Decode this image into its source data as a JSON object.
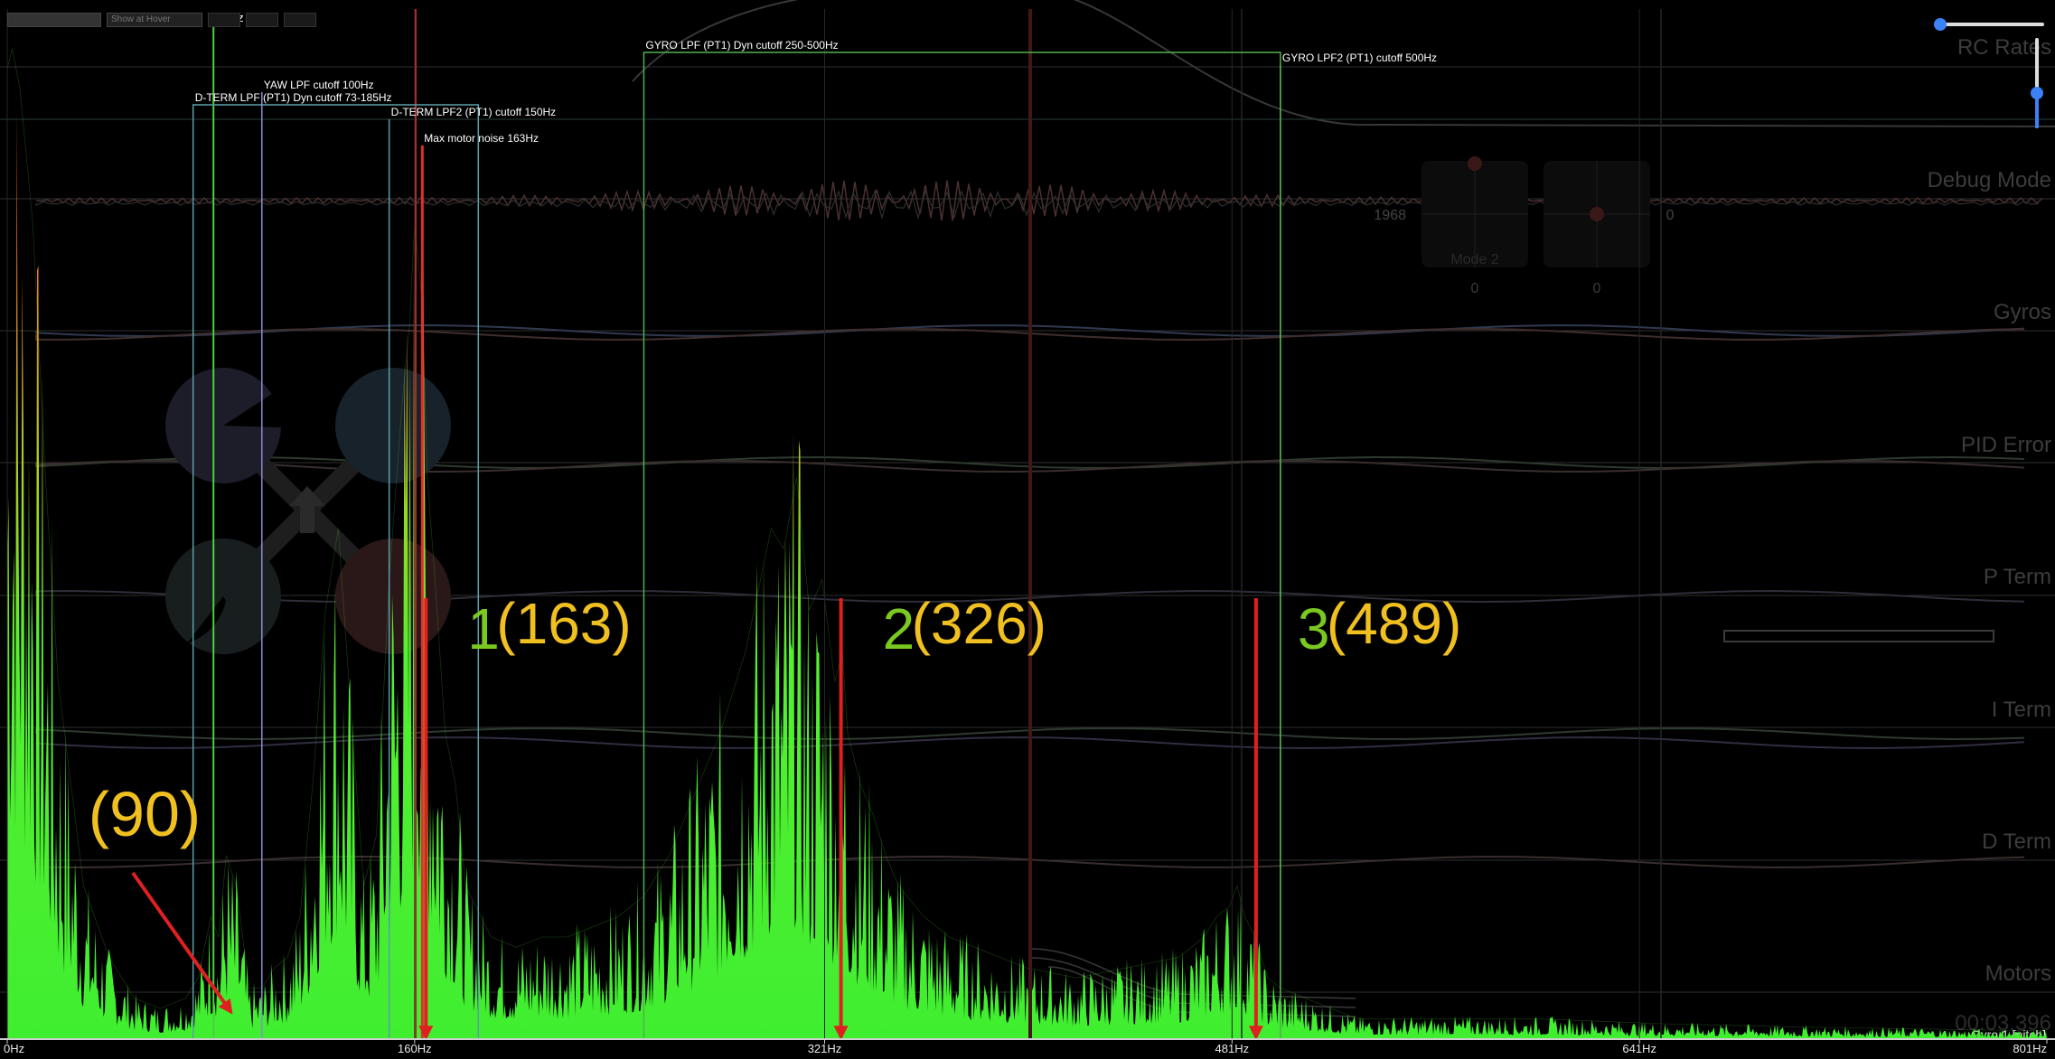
{
  "toolbar": {
    "select_value": "",
    "search_placeholder": "Show at Hover",
    "buttons": [
      "",
      "",
      ""
    ],
    "freq_readout": "81Hz"
  },
  "traces": [
    {
      "label": "RC Rates"
    },
    {
      "label": "Debug Mode"
    },
    {
      "label": "Gyros"
    },
    {
      "label": "PID Error"
    },
    {
      "label": "P Term"
    },
    {
      "label": "I Term"
    },
    {
      "label": "D Term"
    },
    {
      "label": "Motors"
    }
  ],
  "stick_overlay": {
    "mode_label": "Mode 2",
    "left_value": "1968",
    "right_value": "0",
    "bottom_left": "0",
    "bottom_right": "0"
  },
  "timestamp": "00:03.396",
  "spectrum_label": "Gyro 1 [pitch]",
  "chart_data": {
    "type": "area",
    "title": "",
    "xlabel": "",
    "ylabel": "",
    "xlim": [
      0,
      801
    ],
    "x_ticks": [
      "0Hz",
      "160Hz",
      "321Hz",
      "481Hz",
      "641Hz",
      "801Hz"
    ],
    "tick_values": [
      0,
      160,
      321,
      481,
      641,
      801
    ],
    "series": [
      {
        "x": [
          0,
          2,
          5,
          10,
          15,
          20,
          30,
          40,
          50,
          60,
          70,
          75,
          80,
          83,
          86,
          90,
          95,
          100,
          105,
          110,
          115,
          120,
          125,
          130,
          135,
          140,
          145,
          150,
          155,
          158,
          160,
          163,
          165,
          168,
          172,
          176,
          180,
          190,
          200,
          210,
          220,
          230,
          240,
          250,
          260,
          270,
          280,
          290,
          300,
          305,
          310,
          315,
          320,
          325,
          328,
          330,
          335,
          340,
          345,
          350,
          360,
          370,
          380,
          390,
          400,
          420,
          440,
          460,
          470,
          475,
          480,
          483,
          486,
          490,
          495,
          500,
          510,
          520,
          530,
          540,
          560,
          600,
          650,
          700,
          750,
          801
        ],
        "y": [
          0.95,
          0.97,
          0.93,
          0.8,
          0.55,
          0.35,
          0.15,
          0.08,
          0.04,
          0.03,
          0.04,
          0.06,
          0.12,
          0.1,
          0.18,
          0.15,
          0.05,
          0.05,
          0.07,
          0.08,
          0.12,
          0.25,
          0.42,
          0.5,
          0.32,
          0.15,
          0.2,
          0.45,
          0.62,
          0.7,
          0.8,
          0.72,
          0.55,
          0.45,
          0.3,
          0.25,
          0.15,
          0.1,
          0.09,
          0.1,
          0.1,
          0.11,
          0.12,
          0.14,
          0.18,
          0.24,
          0.3,
          0.38,
          0.5,
          0.48,
          0.55,
          0.42,
          0.45,
          0.35,
          0.38,
          0.3,
          0.25,
          0.22,
          0.18,
          0.15,
          0.12,
          0.1,
          0.09,
          0.08,
          0.07,
          0.06,
          0.07,
          0.08,
          0.1,
          0.12,
          0.13,
          0.15,
          0.12,
          0.1,
          0.06,
          0.05,
          0.04,
          0.03,
          0.02,
          0.02,
          0.02,
          0.02,
          0.015,
          0.012,
          0.01,
          0.008
        ]
      }
    ],
    "filter_markers": [
      {
        "label": "D-TERM LPF (PT1) Dyn cutoff 73-185Hz",
        "from": 73,
        "to": 185,
        "color": "#5a9fa8"
      },
      {
        "label": "YAW LPF cutoff 100Hz",
        "freq": 100,
        "color": "#8c8cd6"
      },
      {
        "label": "D-TERM LPF2 (PT1) cutoff 150Hz",
        "freq": 150,
        "color": "#5a9fa8"
      },
      {
        "label": "Max motor noise 163Hz",
        "freq": 163,
        "color": "#e03030"
      },
      {
        "label": "GYRO LPF (PT1) Dyn cutoff 250-500Hz",
        "from": 250,
        "to": 500,
        "color": "#52b04e"
      },
      {
        "label": "GYRO LPF2 (PT1) cutoff 500Hz",
        "freq": 500,
        "color": "#52b04e"
      }
    ],
    "hover_freq": 81,
    "annotations": [
      {
        "num": "",
        "text": "(90)",
        "target": 90
      },
      {
        "num": "1",
        "text": "(163)",
        "target": 163
      },
      {
        "num": "2",
        "text": "(326)",
        "target": 326
      },
      {
        "num": "3",
        "text": "(489)",
        "target": 489
      }
    ]
  }
}
